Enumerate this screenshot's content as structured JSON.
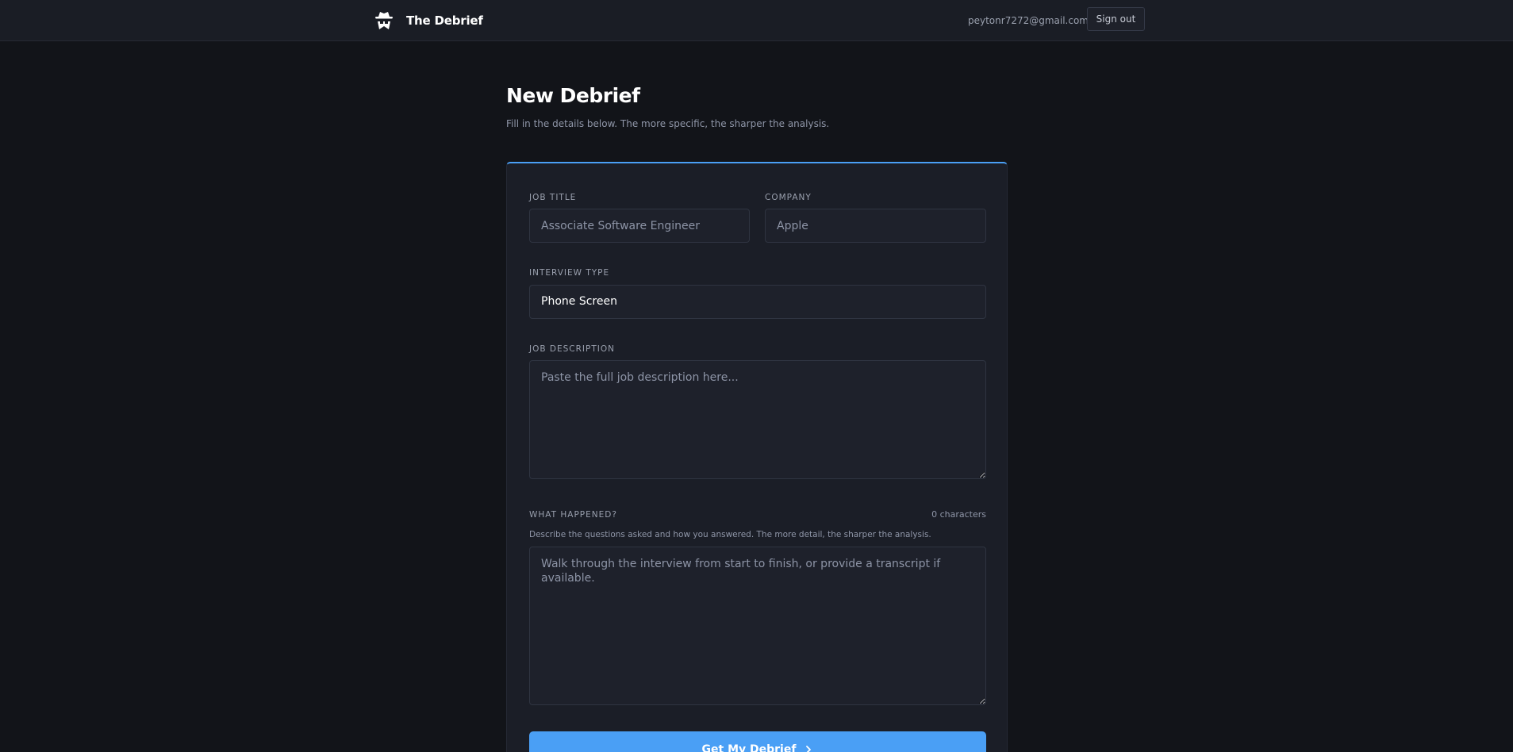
{
  "header": {
    "brand_name": "The Debrief",
    "brand_icon": "spy-incognito-icon",
    "user_email": "peytonr7272@gmail.com",
    "sign_out_label": "Sign out"
  },
  "page": {
    "title": "New Debrief",
    "subtitle": "Fill in the details below. The more specific, the sharper the analysis."
  },
  "form": {
    "job_title": {
      "label": "JOB TITLE",
      "value": "",
      "placeholder": "Associate Software Engineer"
    },
    "company": {
      "label": "COMPANY",
      "value": "",
      "placeholder": "Apple"
    },
    "interview_type": {
      "label": "INTERVIEW TYPE",
      "selected": "Phone Screen"
    },
    "job_description": {
      "label": "JOB DESCRIPTION",
      "value": "",
      "placeholder": "Paste the full job description here..."
    },
    "what_happened": {
      "label": "WHAT HAPPENED?",
      "char_count": "0 characters",
      "hint": "Describe the questions asked and how you answered. The more detail, the sharper the analysis.",
      "value": "",
      "placeholder": "Walk through the interview from start to finish, or provide a transcript if available."
    },
    "submit_label": "Get My Debrief"
  },
  "colors": {
    "accent": "#4a9ff5",
    "background": "#121419",
    "card": "#1b1e27"
  }
}
